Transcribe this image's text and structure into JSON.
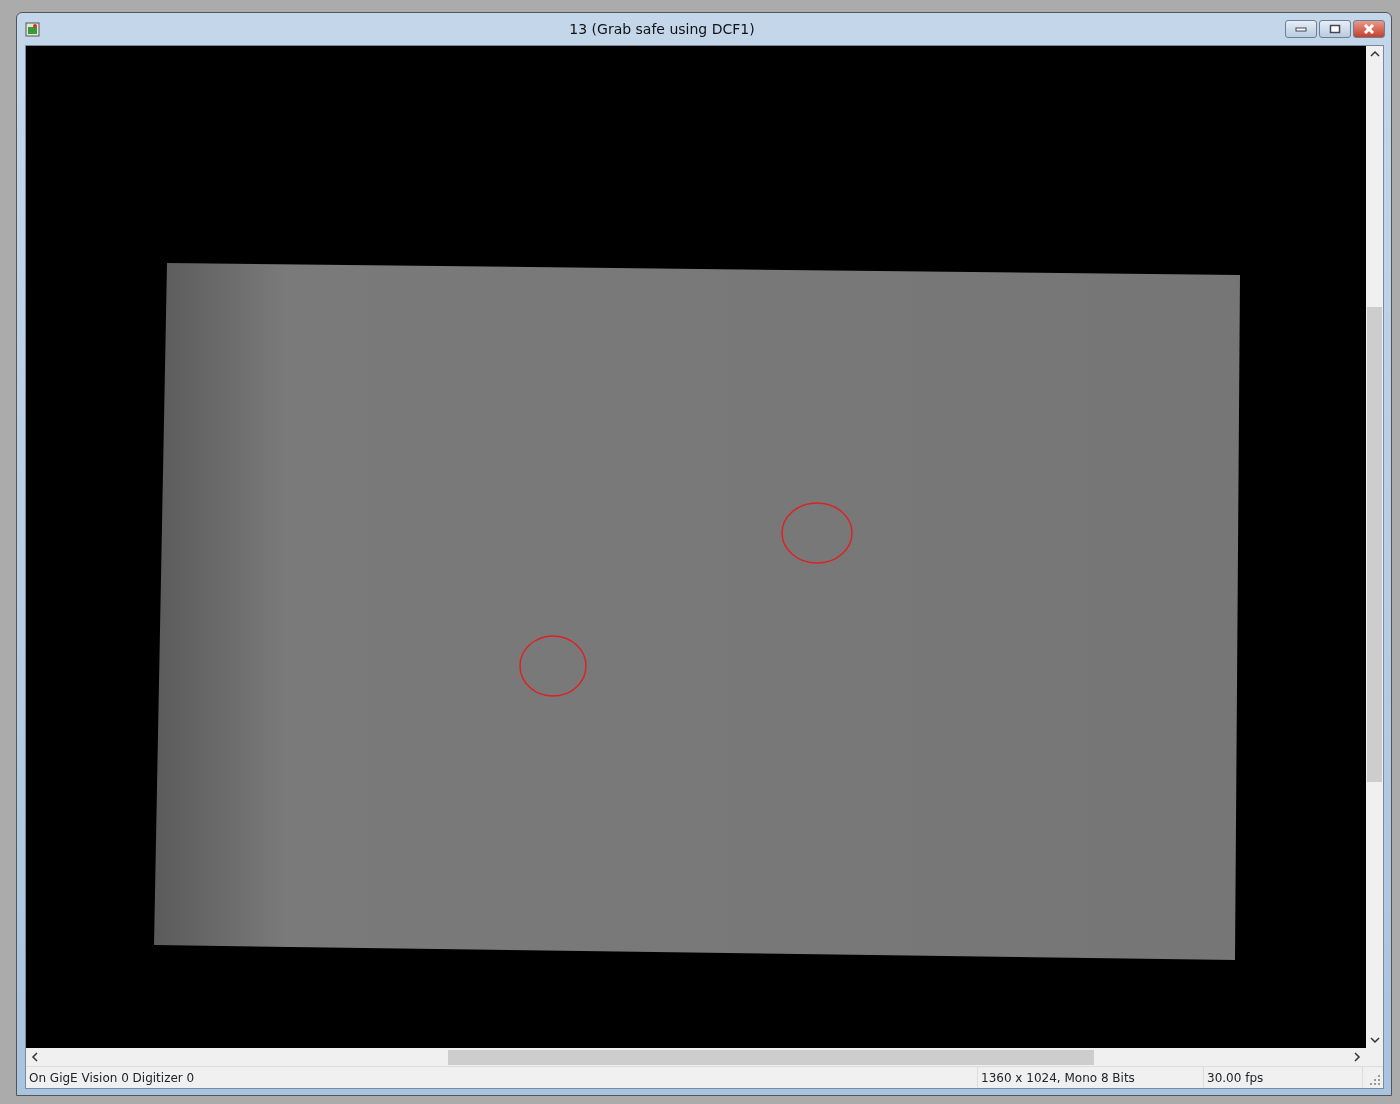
{
  "window": {
    "title": "13 (Grab safe using DCF1)"
  },
  "status_bar": [
    "On GigE Vision 0 Digitizer 0",
    "1360 x 1024, Mono 8 Bits",
    "30.00 fps"
  ]
}
